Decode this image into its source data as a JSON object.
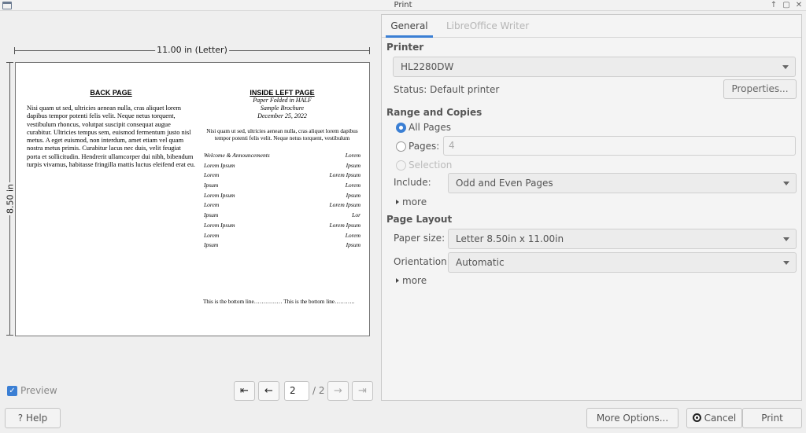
{
  "window": {
    "title": "Print"
  },
  "preview": {
    "width_label": "11.00 in (Letter)",
    "height_label": "8.50 in",
    "document": {
      "left_heading": "BACK PAGE",
      "left_body": "Nisi quam ut sed, ultricies aenean nulla, cras aliquet lorem dapibus tempor potenti felis velit. Neque netus torquent, vestibulum rhoncus, volutpat suscipit consequat augue curabitur. Ultricies tempus sem, euismod fermentum justo nisl metus. A eget euismod, non interdum, amet etiam vel quam nostra metus primis. Curabitur lacus nec duis, velit feugiat porta et sollicitudin. Hendrerit ullamcorper dui nibh, bibendum turpis vivamus, habitasse fringilla mattis luctus eleifend erat eu.",
      "right_heading": "INSIDE LEFT PAGE",
      "right_sub1": "Paper Folded in HALF",
      "right_sub2": "Sample Brochure",
      "right_sub3": "December 25, 2022",
      "right_intro": "Nisi quam ut sed, ultricies aenean nulla, cras aliquet lorem dapibus tempor potenti felis velit. Neque netus torquent, vestibulum",
      "program": [
        [
          "Welcome & Announcements",
          "Lorem"
        ],
        [
          "Lorem Ipsum",
          "Ipsum"
        ],
        [
          "Lorem",
          "Lorem Ipsum"
        ],
        [
          "Ipsum",
          "Lorem"
        ],
        [
          "Lorem Ipsum",
          "Ipsum"
        ],
        [
          "Lorem",
          "Lorem Ipsum"
        ],
        [
          "Ipsum",
          "Lor"
        ],
        [
          "Lorem Ipsum",
          "Lorem Ipsum"
        ],
        [
          "Lorem",
          "Lorem"
        ],
        [
          "Ipsum",
          "Ipsum"
        ]
      ],
      "bottom_line": "This is the bottom line…………… This is the bottom line……….."
    },
    "preview_label": "Preview",
    "current_page": "2",
    "total_pages": "/ 2"
  },
  "tabs": [
    "General",
    "LibreOffice Writer"
  ],
  "printer": {
    "section": "Printer",
    "selected": "HL2280DW",
    "status": "Status: Default printer",
    "properties_label": "Properties..."
  },
  "range": {
    "section": "Range and Copies",
    "all_pages": "All Pages",
    "pages": "Pages:",
    "pages_value": "4",
    "selection": "Selection",
    "include_label": "Include:",
    "include_value": "Odd and Even Pages",
    "more": "more"
  },
  "layout": {
    "section": "Page Layout",
    "paper_size_label": "Paper size:",
    "paper_size_value": "Letter 8.50in x 11.00in",
    "orientation_label": "Orientation:",
    "orientation_value": "Automatic",
    "more": "more"
  },
  "buttons": {
    "help": "Help",
    "more_options": "More Options...",
    "cancel": "Cancel",
    "print": "Print"
  }
}
